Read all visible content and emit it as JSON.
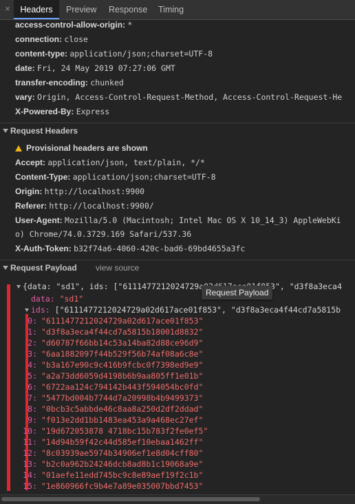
{
  "tabs": {
    "close": "×",
    "items": [
      {
        "label": "Headers",
        "active": true
      },
      {
        "label": "Preview",
        "active": false
      },
      {
        "label": "Response",
        "active": false
      },
      {
        "label": "Timing",
        "active": false
      }
    ]
  },
  "response_headers": [
    {
      "key": "access-control-allow-origin:",
      "value": "*"
    },
    {
      "key": "connection:",
      "value": "close"
    },
    {
      "key": "content-type:",
      "value": "application/json;charset=UTF-8"
    },
    {
      "key": "date:",
      "value": "Fri, 24 May 2019 07:27:06 GMT"
    },
    {
      "key": "transfer-encoding:",
      "value": "chunked"
    },
    {
      "key": "vary:",
      "value": "Origin, Access-Control-Request-Method, Access-Control-Request-He"
    },
    {
      "key": "X-Powered-By:",
      "value": "Express"
    }
  ],
  "request_headers": {
    "title": "Request Headers",
    "warning": "Provisional headers are shown",
    "items": [
      {
        "key": "Accept:",
        "value": "application/json, text/plain, */*"
      },
      {
        "key": "Content-Type:",
        "value": "application/json;charset=UTF-8"
      },
      {
        "key": "Origin:",
        "value": "http://localhost:9900"
      },
      {
        "key": "Referer:",
        "value": "http://localhost:9900/"
      },
      {
        "key": "User-Agent:",
        "value": "Mozilla/5.0 (Macintosh; Intel Mac OS X 10_14_3) AppleWebKi"
      },
      {
        "key": "",
        "value": "o) Chrome/74.0.3729.169 Safari/537.36"
      },
      {
        "key": "X-Auth-Token:",
        "value": "b32f74a6-4060-420c-bad6-69bd4655a3fc"
      }
    ]
  },
  "payload": {
    "title": "Request Payload",
    "view_source": "view source",
    "tooltip": "Request Payload",
    "summary": "{data: \"sd1\", ids: [\"6111477212024729a02d617ace01f853\", \"d3f8a3eca4",
    "data_key": "data:",
    "data_value": "\"sd1\"",
    "ids_key": "ids:",
    "ids_summary": "[\"6111477212024729a02d617ace01f853\", \"d3f8a3eca4f44cd7a5815b",
    "ids": [
      {
        "i": "0:",
        "v": "\"6111477212024729a02d617ace01f853\""
      },
      {
        "i": "1:",
        "v": "\"d3f8a3eca4f44cd7a5815b18001d8832\""
      },
      {
        "i": "2:",
        "v": "\"d60787f66bb14c53a14ba82d88ce96d9\""
      },
      {
        "i": "3:",
        "v": "\"6aa1882097f44b529f56b74af08a6c8e\""
      },
      {
        "i": "4:",
        "v": "\"b3a167e90c9c416b9fcbc0f7398ed9e9\""
      },
      {
        "i": "5:",
        "v": "\"a2a73dd6059d4198b6b9aa805ff1e01b\""
      },
      {
        "i": "6:",
        "v": "\"6722aa124c794142b443f594054bc0fd\""
      },
      {
        "i": "7:",
        "v": "\"5477bd004b7744d7a20998b4b9499373\""
      },
      {
        "i": "8:",
        "v": "\"0bcb3c5abbde46c8aa8a250d2df2ddad\""
      },
      {
        "i": "9:",
        "v": "\"f013e2dd1bb1483ea453a9a468ec27ef\""
      },
      {
        "i": "10:",
        "v": "\"19d672053878 4718bc15b783f2fe0ef5\""
      },
      {
        "i": "11:",
        "v": "\"14d94b59f42c44d585ef10ebaa1462ff\""
      },
      {
        "i": "12:",
        "v": "\"8c03939ae5974b34906ef1e8d04cff80\""
      },
      {
        "i": "13:",
        "v": "\"b2c0a962b24246dcb8ad8b1c19068a9e\""
      },
      {
        "i": "14:",
        "v": "\"01aefe11edd745bc9c8e89aef19f2c1b\""
      },
      {
        "i": "15:",
        "v": "\"1e860966fc9b4e7a89e035007bbd7453\""
      }
    ]
  }
}
